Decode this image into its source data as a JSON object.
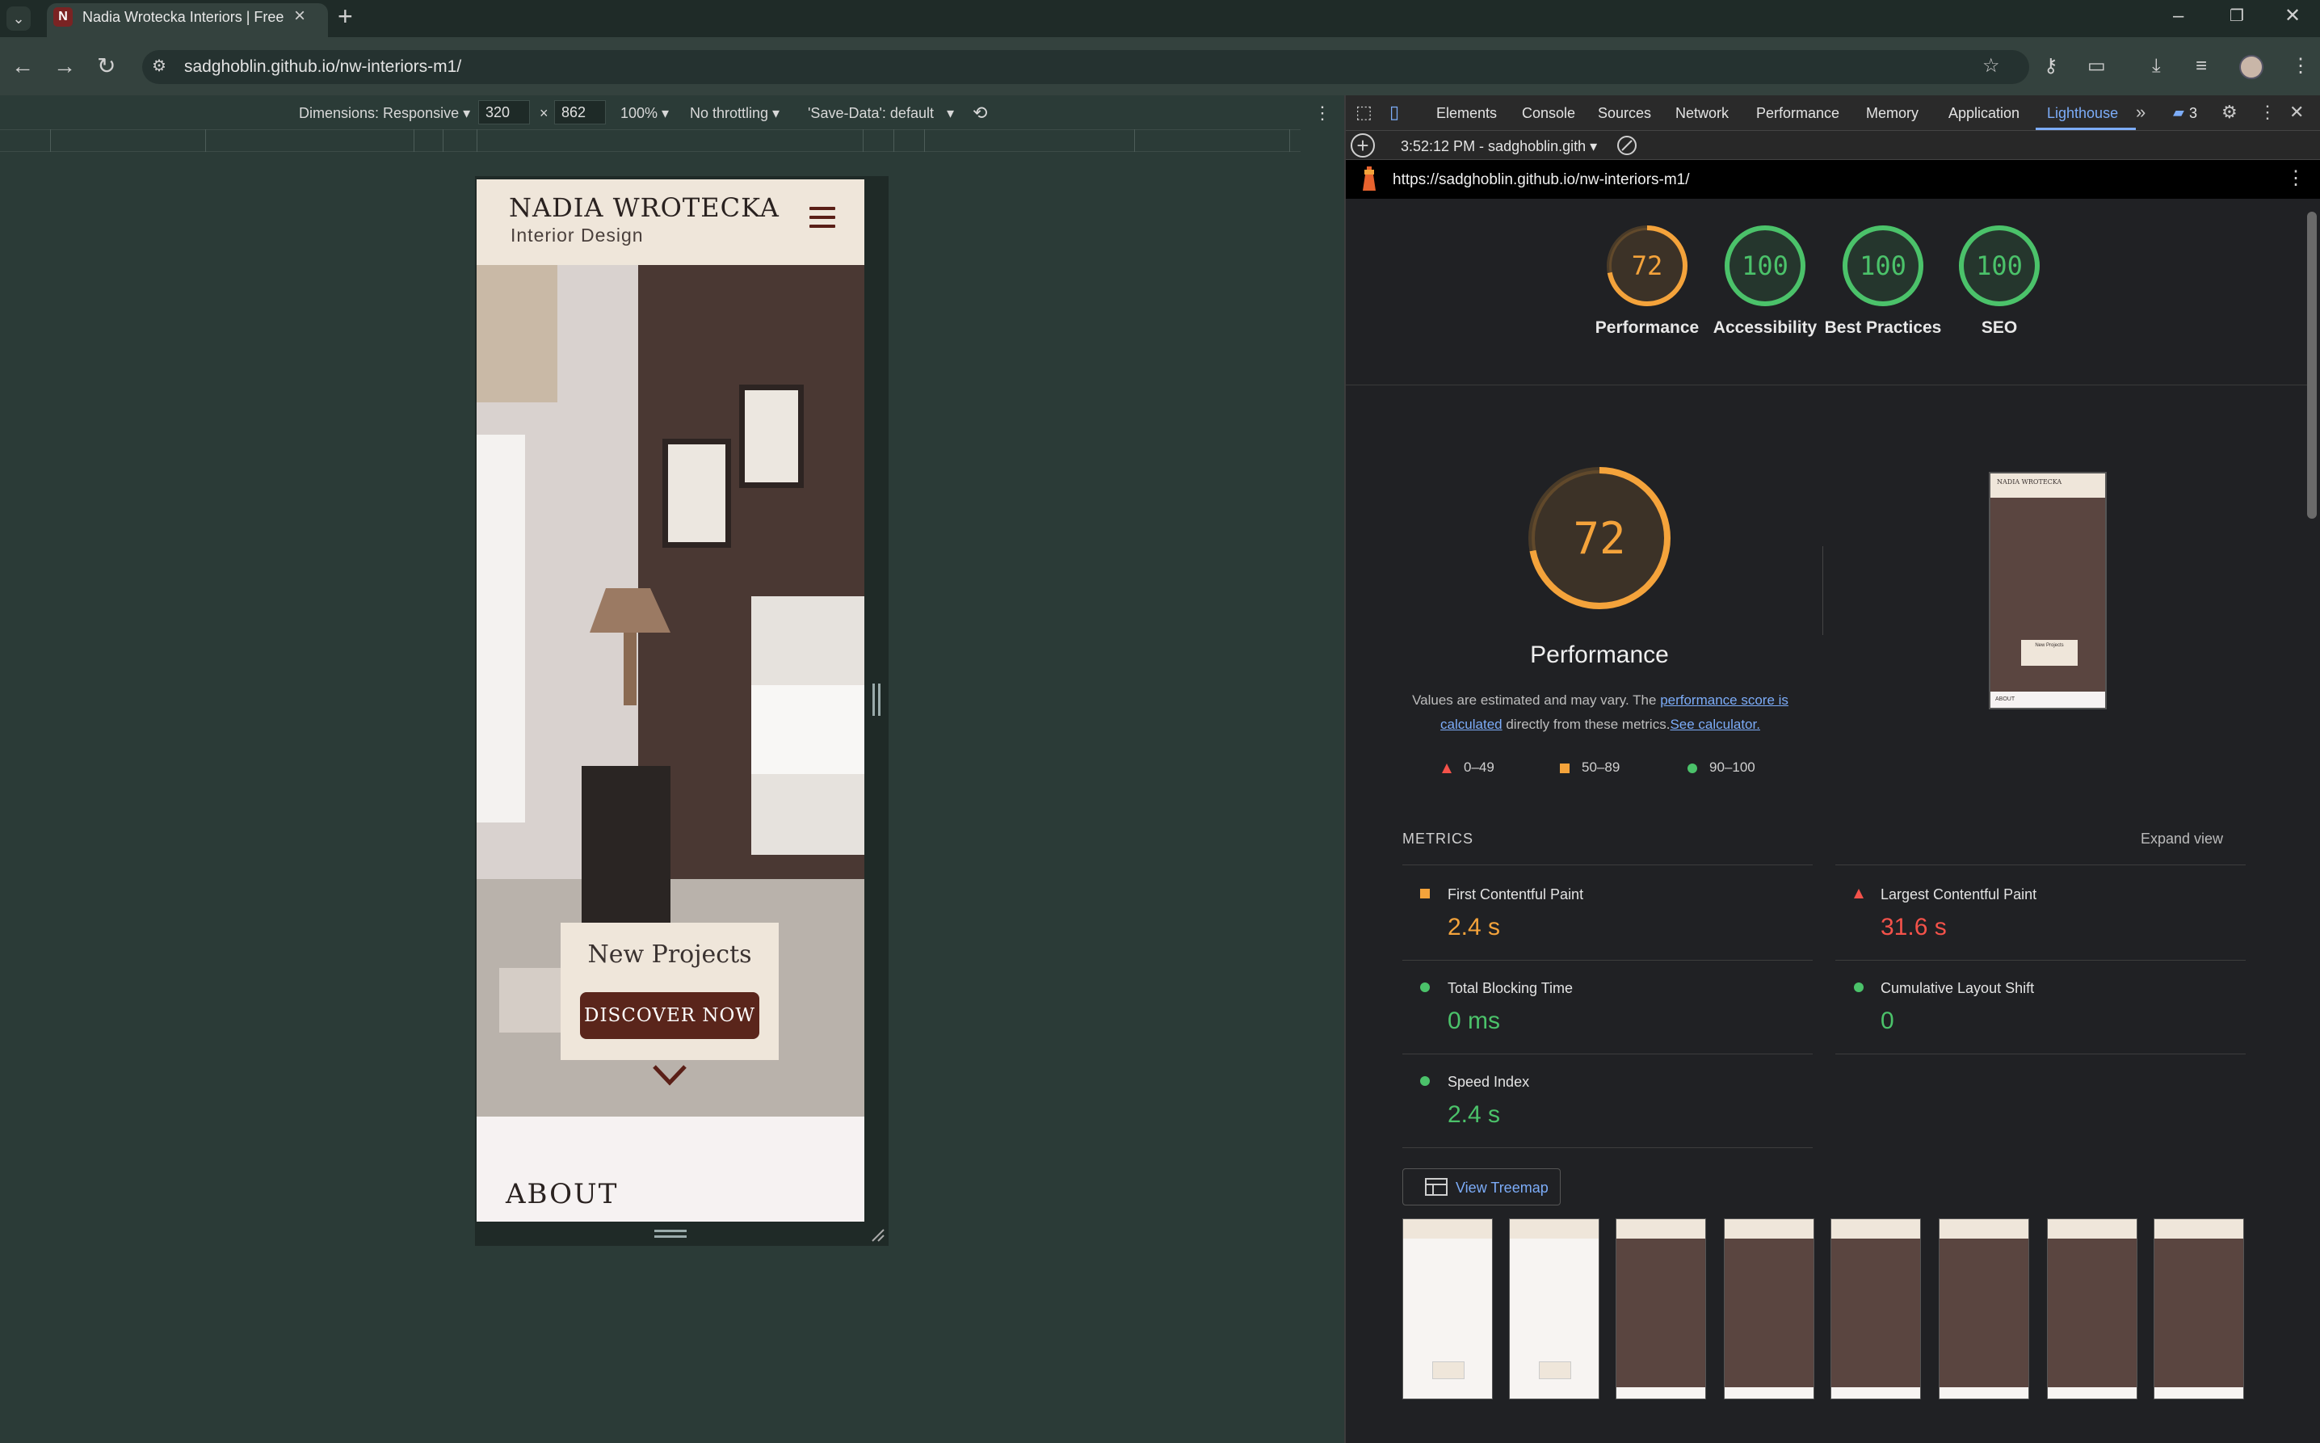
{
  "browser": {
    "tab_title": "Nadia Wrotecka Interiors | Freel",
    "tab_favicon": "N",
    "url": "sadghoblin.github.io/nw-interiors-m1/"
  },
  "device_toolbar": {
    "dimensions": "Dimensions: Responsive ▾",
    "width": "320",
    "times": "×",
    "height": "862",
    "zoom": "100% ▾",
    "throttling": "No throttling ▾",
    "save_data": "'Save-Data': default"
  },
  "site": {
    "brand_name": "NADIA WROTECKA",
    "brand_sub": "Interior Design",
    "cta_title": "New Projects",
    "cta_button": "DISCOVER NOW",
    "about_heading": "ABOUT"
  },
  "devtools": {
    "tabs": [
      "Elements",
      "Console",
      "Sources",
      "Network",
      "Performance",
      "Memory",
      "Application",
      "Lighthouse"
    ],
    "issues_count": "3",
    "report_select": "3:52:12 PM - sadghoblin.gith ▾",
    "report_url": "https://sadghoblin.github.io/nw-interiors-m1/"
  },
  "lighthouse": {
    "scores": [
      {
        "label": "Performance",
        "value": "72",
        "score": 72,
        "color": "#f4a33b"
      },
      {
        "label": "Accessibility",
        "value": "100",
        "score": 100,
        "color": "#4bc26a"
      },
      {
        "label": "Best Practices",
        "value": "100",
        "score": 100,
        "color": "#4bc26a"
      },
      {
        "label": "SEO",
        "value": "100",
        "score": 100,
        "color": "#4bc26a"
      }
    ],
    "big_score": "72",
    "big_title": "Performance",
    "desc_1": "Values are estimated and may vary. The ",
    "desc_link_1": "performance score is calculated",
    "desc_2": " directly from these metrics.",
    "desc_link_2": "See calculator.",
    "legend": [
      {
        "range": "0–49",
        "shape": "triangle",
        "color": "#f4524a"
      },
      {
        "range": "50–89",
        "shape": "square",
        "color": "#f4a33b"
      },
      {
        "range": "90–100",
        "shape": "circle",
        "color": "#4bc26a"
      }
    ],
    "metrics_title": "METRICS",
    "expand_view": "Expand view",
    "metrics": [
      {
        "label": "First Contentful Paint",
        "value": "2.4 s",
        "status": "average"
      },
      {
        "label": "Largest Contentful Paint",
        "value": "31.6 s",
        "status": "fail"
      },
      {
        "label": "Total Blocking Time",
        "value": "0 ms",
        "status": "pass"
      },
      {
        "label": "Cumulative Layout Shift",
        "value": "0",
        "status": "pass"
      },
      {
        "label": "Speed Index",
        "value": "2.4 s",
        "status": "pass"
      }
    ],
    "treemap_label": "View Treemap",
    "screenshot_brand": "NADIA WROTECKA",
    "screenshot_cta": "New Projects",
    "screenshot_about": "ABOUT"
  },
  "colors": {
    "page_bg": "#2b3b37",
    "brand_accent": "#5a251b",
    "lighthouse_tab": "#7cacf8"
  }
}
